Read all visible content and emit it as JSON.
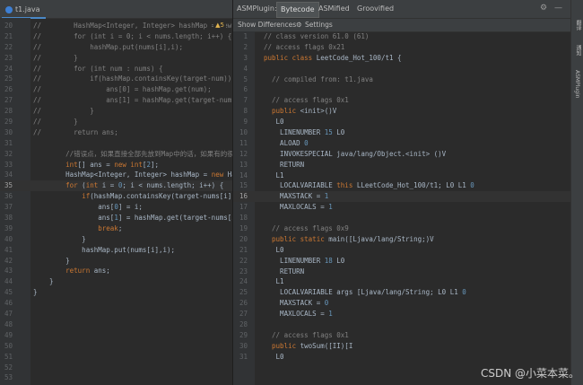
{
  "editor": {
    "tab_label": "t1.java",
    "warning_count": "▲5",
    "current_line": 35,
    "lines": [
      {
        "n": "20",
        "t": "//        HashMap<Integer, Integer> hashMap = new H"
      },
      {
        "n": "21",
        "t": "//        for (int i = 0; i < nums.length; i++) {"
      },
      {
        "n": "22",
        "t": "//            hashMap.put(nums[i],i);"
      },
      {
        "n": "23",
        "t": "//        }"
      },
      {
        "n": "24",
        "t": "//        for (int num : nums) {"
      },
      {
        "n": "25",
        "t": "//            if(hashMap.containsKey(target-num)){"
      },
      {
        "n": "26",
        "t": "//                ans[0] = hashMap.get(num);"
      },
      {
        "n": "27",
        "t": "//                ans[1] = hashMap.get(target-num);"
      },
      {
        "n": "28",
        "t": "//            }"
      },
      {
        "n": "29",
        "t": "//        }"
      },
      {
        "n": "30",
        "t": "//        return ans;"
      },
      {
        "n": "31",
        "t": ""
      },
      {
        "n": "32",
        "t": "        //错误点，如果直接全部先放到Map中的话，如果有的很是"
      },
      {
        "n": "33",
        "t": "        int[] ans = new int[2];"
      },
      {
        "n": "34",
        "t": "        HashMap<Integer, Integer> hashMap = new Ha"
      },
      {
        "n": "35",
        "t": "        for (int i = 0; i < nums.length; i++) {"
      },
      {
        "n": "36",
        "t": "            if(hashMap.containsKey(target-nums[i])"
      },
      {
        "n": "37",
        "t": "                ans[0] = i;"
      },
      {
        "n": "38",
        "t": "                ans[1] = hashMap.get(target-nums[i"
      },
      {
        "n": "39",
        "t": "                break;"
      },
      {
        "n": "40",
        "t": "            }"
      },
      {
        "n": "41",
        "t": "            hashMap.put(nums[i],i);"
      },
      {
        "n": "42",
        "t": "        }"
      },
      {
        "n": "43",
        "t": "        return ans;"
      },
      {
        "n": "44",
        "t": "    }"
      },
      {
        "n": "45",
        "t": "}"
      },
      {
        "n": "46",
        "t": ""
      },
      {
        "n": "47",
        "t": ""
      },
      {
        "n": "48",
        "t": ""
      },
      {
        "n": "49",
        "t": ""
      },
      {
        "n": "50",
        "t": ""
      },
      {
        "n": "51",
        "t": ""
      },
      {
        "n": "52",
        "t": ""
      },
      {
        "n": "53",
        "t": ""
      }
    ]
  },
  "asm": {
    "title": "ASMPlugin:",
    "tabs": [
      "Bytecode",
      "ASMified",
      "Groovified"
    ],
    "show_differences": "Show Differences",
    "settings": "Settings",
    "current_line": 16,
    "lines": [
      {
        "n": "1",
        "t": "// class version 61.0 (61)"
      },
      {
        "n": "2",
        "t": "// access flags 0x21"
      },
      {
        "n": "3",
        "t": "public class LeetCode_Hot_100/t1 {"
      },
      {
        "n": "4",
        "t": ""
      },
      {
        "n": "5",
        "t": "  // compiled from: t1.java"
      },
      {
        "n": "6",
        "t": ""
      },
      {
        "n": "7",
        "t": "  // access flags 0x1"
      },
      {
        "n": "8",
        "t": "  public <init>()V"
      },
      {
        "n": "9",
        "t": "   L0"
      },
      {
        "n": "10",
        "t": "    LINENUMBER 15 L0"
      },
      {
        "n": "11",
        "t": "    ALOAD 0"
      },
      {
        "n": "12",
        "t": "    INVOKESPECIAL java/lang/Object.<init> ()V"
      },
      {
        "n": "13",
        "t": "    RETURN"
      },
      {
        "n": "14",
        "t": "   L1"
      },
      {
        "n": "15",
        "t": "    LOCALVARIABLE this LLeetCode_Hot_100/t1; L0 L1 0"
      },
      {
        "n": "16",
        "t": "    MAXSTACK = 1"
      },
      {
        "n": "17",
        "t": "    MAXLOCALS = 1"
      },
      {
        "n": "18",
        "t": ""
      },
      {
        "n": "19",
        "t": "  // access flags 0x9"
      },
      {
        "n": "20",
        "t": "  public static main([Ljava/lang/String;)V"
      },
      {
        "n": "21",
        "t": "   L0"
      },
      {
        "n": "22",
        "t": "    LINENUMBER 18 L0"
      },
      {
        "n": "23",
        "t": "    RETURN"
      },
      {
        "n": "24",
        "t": "   L1"
      },
      {
        "n": "25",
        "t": "    LOCALVARIABLE args [Ljava/lang/String; L0 L1 0"
      },
      {
        "n": "26",
        "t": "    MAXSTACK = 0"
      },
      {
        "n": "27",
        "t": "    MAXLOCALS = 1"
      },
      {
        "n": "28",
        "t": ""
      },
      {
        "n": "29",
        "t": "  // access flags 0x1"
      },
      {
        "n": "30",
        "t": "  public twoSum([II)[I"
      },
      {
        "n": "31",
        "t": "   L0"
      }
    ]
  },
  "side_strip": {
    "labels": [
      "翻译",
      "通知",
      "ASMPlugin"
    ]
  },
  "watermark": "CSDN @小菜本菜。"
}
